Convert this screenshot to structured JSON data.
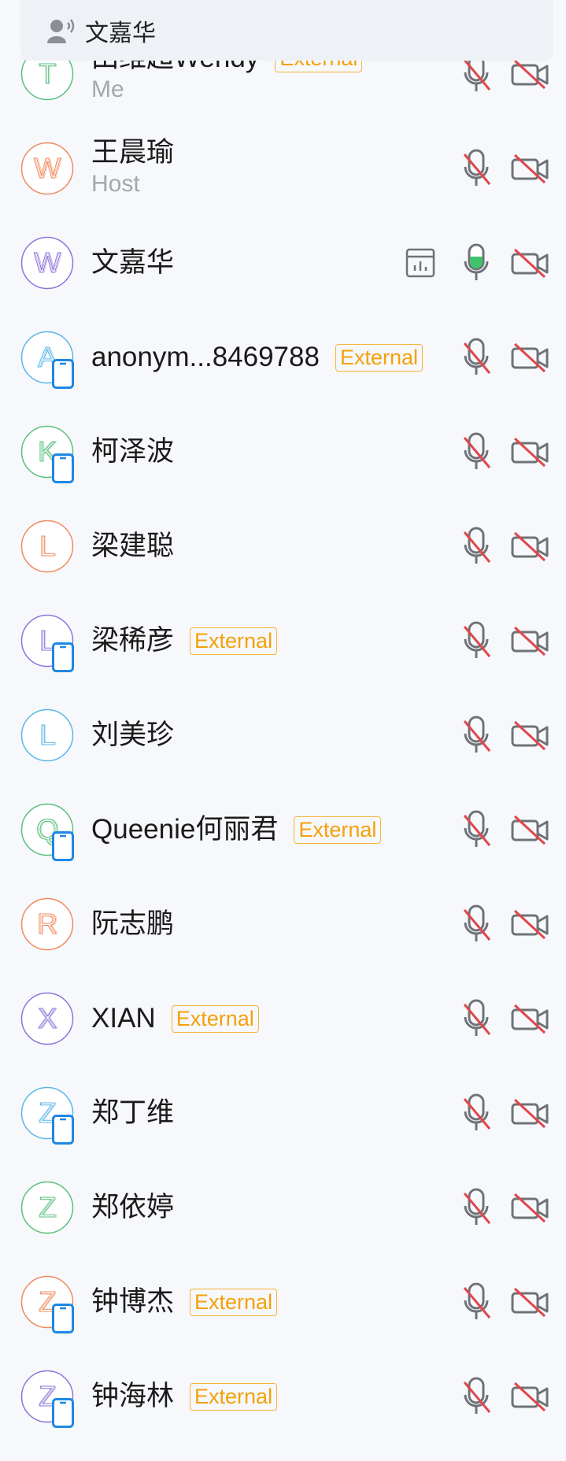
{
  "speaking": {
    "icon": "speaking-person-icon",
    "label": "文嘉华"
  },
  "participants": [
    {
      "name": "田维超Wendy",
      "badge": "External",
      "role": "Me",
      "letter": "T",
      "color": "#5bbf7d",
      "device": false,
      "speaking": false
    },
    {
      "name": "王晨瑜",
      "badge": "",
      "role": "Host",
      "letter": "W",
      "color": "#f08a5d",
      "device": false,
      "speaking": false
    },
    {
      "name": "文嘉华",
      "badge": "",
      "role": "",
      "letter": "W",
      "color": "#8d74d9",
      "device": false,
      "speaking": true
    },
    {
      "name": "anonym...8469788",
      "badge": "External",
      "role": "",
      "letter": "A",
      "color": "#5ab6e8",
      "device": true,
      "speaking": false
    },
    {
      "name": "柯泽波",
      "badge": "",
      "role": "",
      "letter": "K",
      "color": "#5bbf7d",
      "device": true,
      "speaking": false
    },
    {
      "name": "梁建聪",
      "badge": "",
      "role": "",
      "letter": "L",
      "color": "#f08a5d",
      "device": false,
      "speaking": false
    },
    {
      "name": "梁稀彦",
      "badge": "External",
      "role": "",
      "letter": "L",
      "color": "#8d74d9",
      "device": true,
      "speaking": false
    },
    {
      "name": "刘美珍",
      "badge": "",
      "role": "",
      "letter": "L",
      "color": "#5ab6e8",
      "device": false,
      "speaking": false
    },
    {
      "name": "Queenie何丽君",
      "badge": "External",
      "role": "",
      "letter": "Q",
      "color": "#5bbf7d",
      "device": true,
      "speaking": false
    },
    {
      "name": "阮志鹏",
      "badge": "",
      "role": "",
      "letter": "R",
      "color": "#f08a5d",
      "device": false,
      "speaking": false
    },
    {
      "name": "XIAN",
      "badge": "External",
      "role": "",
      "letter": "X",
      "color": "#8d74d9",
      "device": false,
      "speaking": false
    },
    {
      "name": "郑丁维",
      "badge": "",
      "role": "",
      "letter": "Z",
      "color": "#5ab6e8",
      "device": true,
      "speaking": false
    },
    {
      "name": "郑依婷",
      "badge": "",
      "role": "",
      "letter": "Z",
      "color": "#5bbf7d",
      "device": false,
      "speaking": false
    },
    {
      "name": "钟博杰",
      "badge": "External",
      "role": "",
      "letter": "Z",
      "color": "#f08a5d",
      "device": true,
      "speaking": false
    },
    {
      "name": "钟海林",
      "badge": "External",
      "role": "",
      "letter": "Z",
      "color": "#8d74d9",
      "device": true,
      "speaking": false
    }
  ],
  "icons": {
    "mic_muted": "mic-muted-icon",
    "mic_active": "mic-active-icon",
    "camera_off": "camera-off-icon",
    "stats": "stats-icon",
    "mobile_device": "mobile-device-icon"
  },
  "colors": {
    "muted_red": "#e0474c",
    "icon_gray": "#6f7378",
    "active_green": "#3ec36a",
    "external_orange": "#f5a00a",
    "mobile_blue": "#1e88e5"
  }
}
